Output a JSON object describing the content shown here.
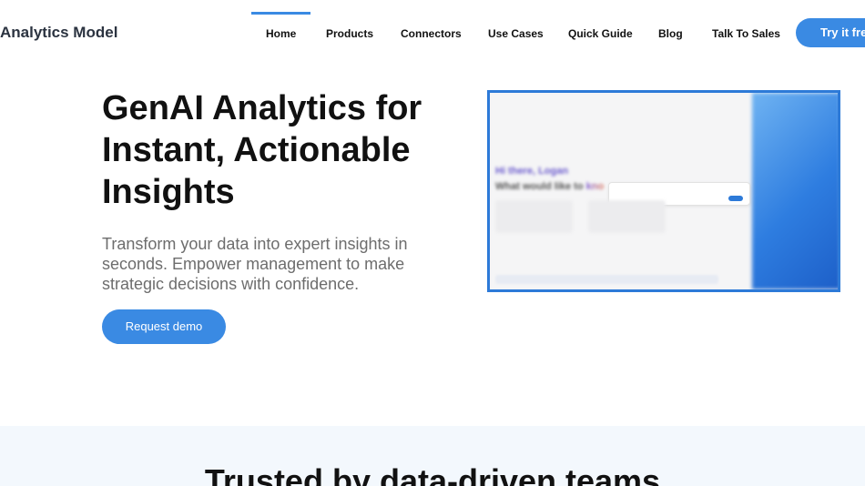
{
  "header": {
    "brand": "Analytics Model",
    "nav": [
      {
        "label": "Home",
        "active": true
      },
      {
        "label": "Products"
      },
      {
        "label": "Connectors"
      },
      {
        "label": "Use Cases"
      },
      {
        "label": "Quick Guide"
      },
      {
        "label": "Blog"
      },
      {
        "label": "Talk To Sales"
      }
    ],
    "cta_label": "Try it free"
  },
  "hero": {
    "title_lines": [
      "GenAI Analytics for",
      "Instant, Actionable",
      "Insights"
    ],
    "subtitle": "Transform your data into expert insights in seconds. Empower management to make strategic decisions with confidence.",
    "button_label": "Request demo"
  },
  "preview": {
    "greeting": "Hi there, Logan",
    "question_prefix": "What would like to ",
    "question_suffix": "kno"
  },
  "trusted": {
    "title": "Trusted by data-driven teams"
  },
  "colors": {
    "accent": "#3a8ae3",
    "preview_border": "#2d7ad8",
    "section_bg": "#f3f8fd"
  }
}
